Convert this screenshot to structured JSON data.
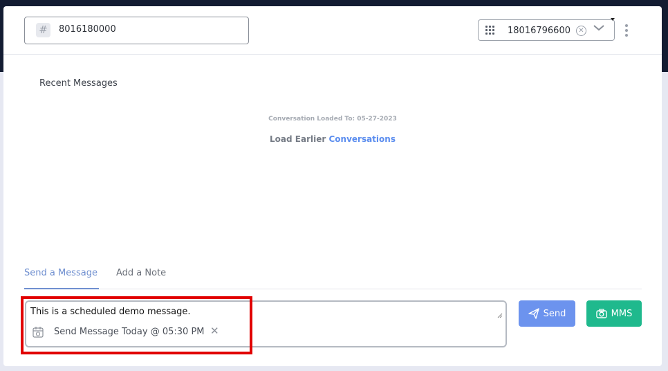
{
  "header": {
    "number_icon": "hash-icon",
    "number_value": "8016180000",
    "from_select": {
      "value": "18016796600",
      "icons": [
        "dialpad-icon",
        "clear-icon",
        "chevron-down-icon"
      ]
    },
    "menu_icon": "kebab-menu-icon"
  },
  "messages": {
    "title": "Recent Messages",
    "loaded_to": "Conversation Loaded To: 05-27-2023",
    "load_earlier_prefix": "Load Earlier",
    "load_earlier_link": "Conversations"
  },
  "tabs": [
    {
      "label": "Send a Message",
      "active": true
    },
    {
      "label": "Add a Note",
      "active": false
    }
  ],
  "compose": {
    "text": "This is a scheduled demo message.",
    "schedule_label": "Send Message Today @ 05:30 PM",
    "schedule_icon": "calendar-clock-icon",
    "schedule_close": "✕"
  },
  "buttons": {
    "send_label": "Send",
    "mms_label": "MMS"
  },
  "colors": {
    "accent_blue": "#6c93ee",
    "mms_green": "#1fb98d",
    "highlight_red": "#e10000",
    "link_blue": "#5b8def"
  }
}
